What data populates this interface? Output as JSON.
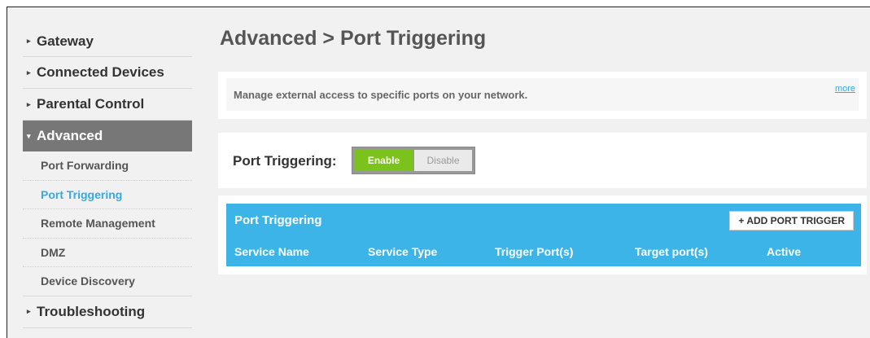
{
  "sidebar": {
    "items": [
      {
        "label": "Gateway"
      },
      {
        "label": "Connected Devices"
      },
      {
        "label": "Parental Control"
      },
      {
        "label": "Advanced"
      },
      {
        "label": "Troubleshooting"
      }
    ],
    "sub_items": [
      {
        "label": "Port Forwarding"
      },
      {
        "label": "Port Triggering"
      },
      {
        "label": "Remote Management"
      },
      {
        "label": "DMZ"
      },
      {
        "label": "Device Discovery"
      }
    ],
    "current_sub": "Port Triggering"
  },
  "page": {
    "title": "Advanced > Port Triggering",
    "intro": "Manage external access to specific ports on your network.",
    "more_link": "more"
  },
  "toggle": {
    "label": "Port Triggering:",
    "enable": "Enable",
    "disable": "Disable",
    "state": "Enable"
  },
  "table": {
    "title": "Port Triggering",
    "add_button": "+ ADD PORT TRIGGER",
    "columns": [
      "Service Name",
      "Service Type",
      "Trigger Port(s)",
      "Target port(s)",
      "Active"
    ]
  },
  "colors": {
    "accent": "#3db4e8",
    "enable_green": "#7cc21c",
    "active_nav": "#777777"
  }
}
